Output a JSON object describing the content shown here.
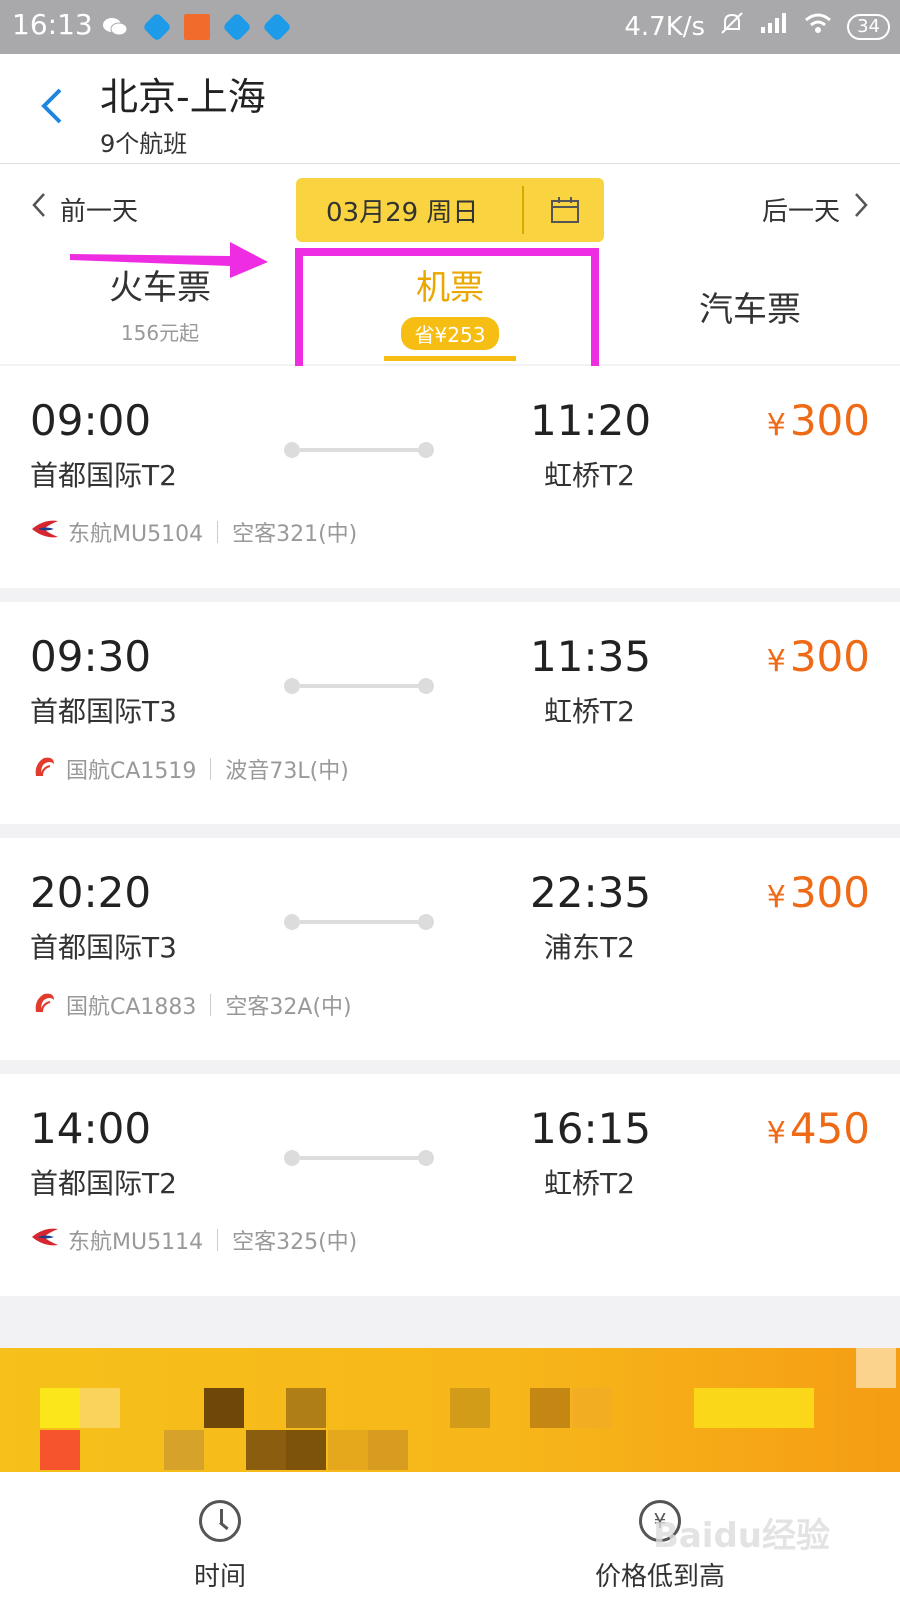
{
  "status_bar": {
    "time": "16:13",
    "network_speed": "4.7K/s",
    "battery": "34"
  },
  "header": {
    "title": "北京-上海",
    "subtitle": "9个航班"
  },
  "date_nav": {
    "prev": "前一天",
    "next": "后一天",
    "date": "03月29 周日"
  },
  "tabs": {
    "train": {
      "name": "火车票",
      "sub": "156元起"
    },
    "flight": {
      "name": "机票",
      "badge": "省¥253"
    },
    "bus": {
      "name": "汽车票"
    }
  },
  "flights": [
    {
      "dep_time": "09:00",
      "dep_airport": "首都国际T2",
      "arr_time": "11:20",
      "arr_airport": "虹桥T2",
      "currency": "¥",
      "price": "300",
      "airline": "东航MU5104",
      "aircraft": "空客321(中)",
      "airline_logo": "china-eastern-logo",
      "logo_color": "#d6262f"
    },
    {
      "dep_time": "09:30",
      "dep_airport": "首都国际T3",
      "arr_time": "11:35",
      "arr_airport": "虹桥T2",
      "currency": "¥",
      "price": "300",
      "airline": "国航CA1519",
      "aircraft": "波音73L(中)",
      "airline_logo": "air-china-logo",
      "logo_color": "#e23a2c"
    },
    {
      "dep_time": "20:20",
      "dep_airport": "首都国际T3",
      "arr_time": "22:35",
      "arr_airport": "浦东T2",
      "currency": "¥",
      "price": "300",
      "airline": "国航CA1883",
      "aircraft": "空客32A(中)",
      "airline_logo": "air-china-logo",
      "logo_color": "#e23a2c"
    },
    {
      "dep_time": "14:00",
      "dep_airport": "首都国际T2",
      "arr_time": "16:15",
      "arr_airport": "虹桥T2",
      "currency": "¥",
      "price": "450",
      "airline": "东航MU5114",
      "aircraft": "空客325(中)",
      "airline_logo": "china-eastern-logo",
      "logo_color": "#d6262f"
    }
  ],
  "bottom_bar": {
    "time_sort": "时间",
    "price_sort": "价格低到高"
  },
  "watermark": "Baidu经验",
  "colors": {
    "accent_yellow": "#fad440",
    "price_orange": "#ef6a16",
    "highlight_magenta": "#ee2de2"
  }
}
